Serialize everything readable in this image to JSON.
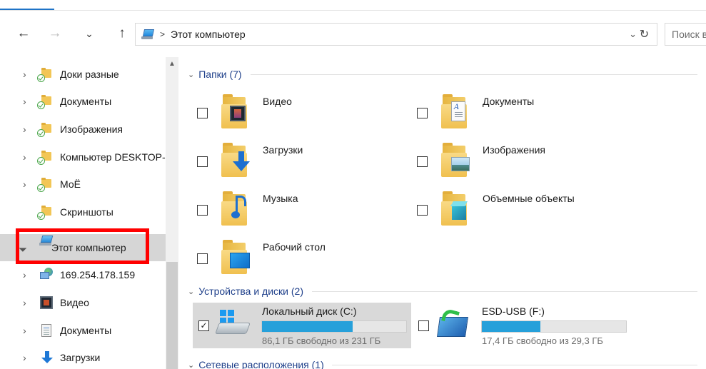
{
  "address": {
    "breadcrumb_sep": ">",
    "location": "Этот компьютер",
    "search_placeholder": "Поиск в: Этот компьютер"
  },
  "nav": {
    "back": "←",
    "forward": "→",
    "recent": "⌄",
    "up": "↑",
    "dropdown": "⌄",
    "refresh": "↻"
  },
  "sidebar": {
    "items": [
      {
        "label": "Доки разные",
        "icon": "folder-synced-icon"
      },
      {
        "label": "Документы",
        "icon": "folder-synced-icon"
      },
      {
        "label": "Изображения",
        "icon": "folder-synced-icon"
      },
      {
        "label": "Компьютер DESKTOP-",
        "icon": "folder-synced-icon"
      },
      {
        "label": "МоЁ",
        "icon": "folder-synced-icon"
      },
      {
        "label": "Скриншоты",
        "icon": "folder-synced-icon"
      },
      {
        "label": "Этот компьютер",
        "icon": "this-pc-icon",
        "selected": true
      },
      {
        "label": "169.254.178.159",
        "icon": "network-location-icon"
      },
      {
        "label": "Видео",
        "icon": "video-icon"
      },
      {
        "label": "Документы",
        "icon": "documents-icon"
      },
      {
        "label": "Загрузки",
        "icon": "downloads-icon"
      }
    ]
  },
  "groups": {
    "folders": {
      "title": "Папки (7)"
    },
    "devices": {
      "title": "Устройства и диски (2)"
    },
    "network": {
      "title": "Сетевые расположения (1)"
    }
  },
  "folders": [
    {
      "label": "Видео",
      "icon": "video-folder-icon"
    },
    {
      "label": "Документы",
      "icon": "documents-folder-icon"
    },
    {
      "label": "Загрузки",
      "icon": "downloads-folder-icon"
    },
    {
      "label": "Изображения",
      "icon": "pictures-folder-icon"
    },
    {
      "label": "Музыка",
      "icon": "music-folder-icon"
    },
    {
      "label": "Объемные объекты",
      "icon": "3d-objects-folder-icon"
    },
    {
      "label": "Рабочий стол",
      "icon": "desktop-folder-icon"
    }
  ],
  "drives": [
    {
      "name": "Локальный диск (C:)",
      "free_text": "86,1 ГБ свободно из 231 ГБ",
      "used_fraction": 0.627,
      "checked": true,
      "selected": true,
      "icon": "local-disk-icon"
    },
    {
      "name": "ESD-USB (F:)",
      "free_text": "17,4 ГБ свободно из 29,3 ГБ",
      "used_fraction": 0.406,
      "checked": false,
      "selected": false,
      "icon": "usb-drive-icon"
    }
  ],
  "colors": {
    "accent": "#26a0da",
    "group_header": "#1e3f8a",
    "highlight": "#ff0000",
    "selection": "#d9d9d9"
  }
}
